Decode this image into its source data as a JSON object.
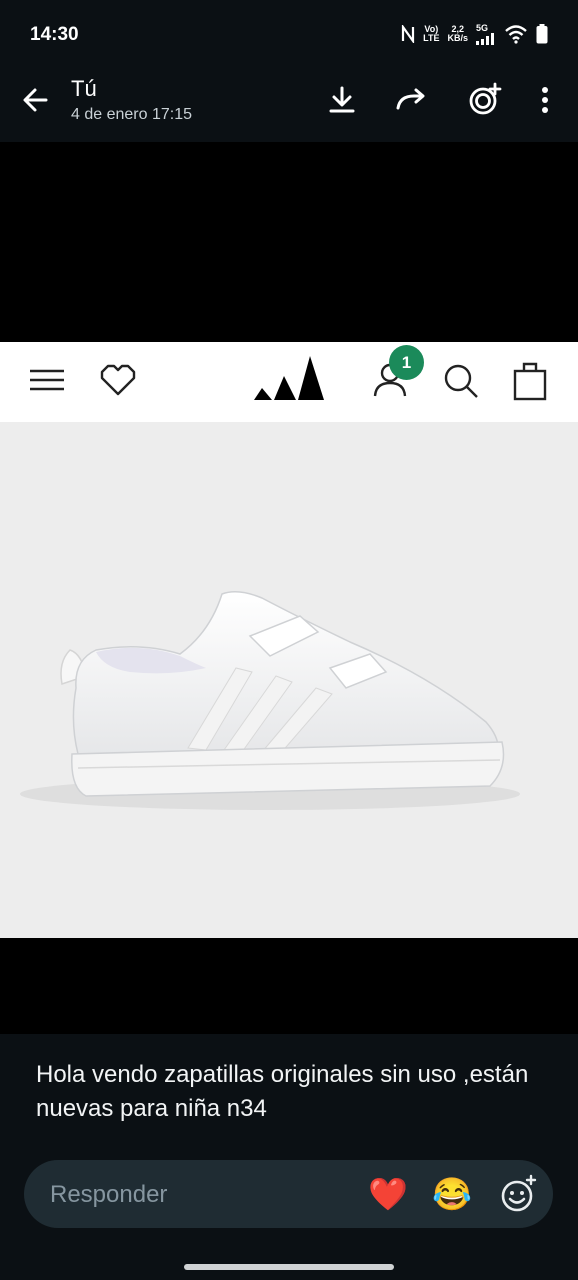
{
  "status_bar": {
    "time": "14:30",
    "network_primary": "Vo)",
    "network_secondary": "LTE",
    "speed_value": "2,2",
    "speed_unit": "KB/s",
    "signal_label": "5G"
  },
  "header": {
    "title": "Tú",
    "subtitle": "4 de enero 17:15"
  },
  "shop_header": {
    "cart_badge": "1",
    "brand": "adidas"
  },
  "caption": {
    "text": "Hola vendo zapatillas originales sin uso ,están nuevas para niña n34"
  },
  "reply": {
    "placeholder": "Responder"
  },
  "emoji_reactions": {
    "heart": "❤️",
    "laugh": "😂"
  },
  "colors": {
    "bar_background": "#0b1014",
    "reply_background": "#1f2c33",
    "badge_green": "#1b8a5a"
  }
}
